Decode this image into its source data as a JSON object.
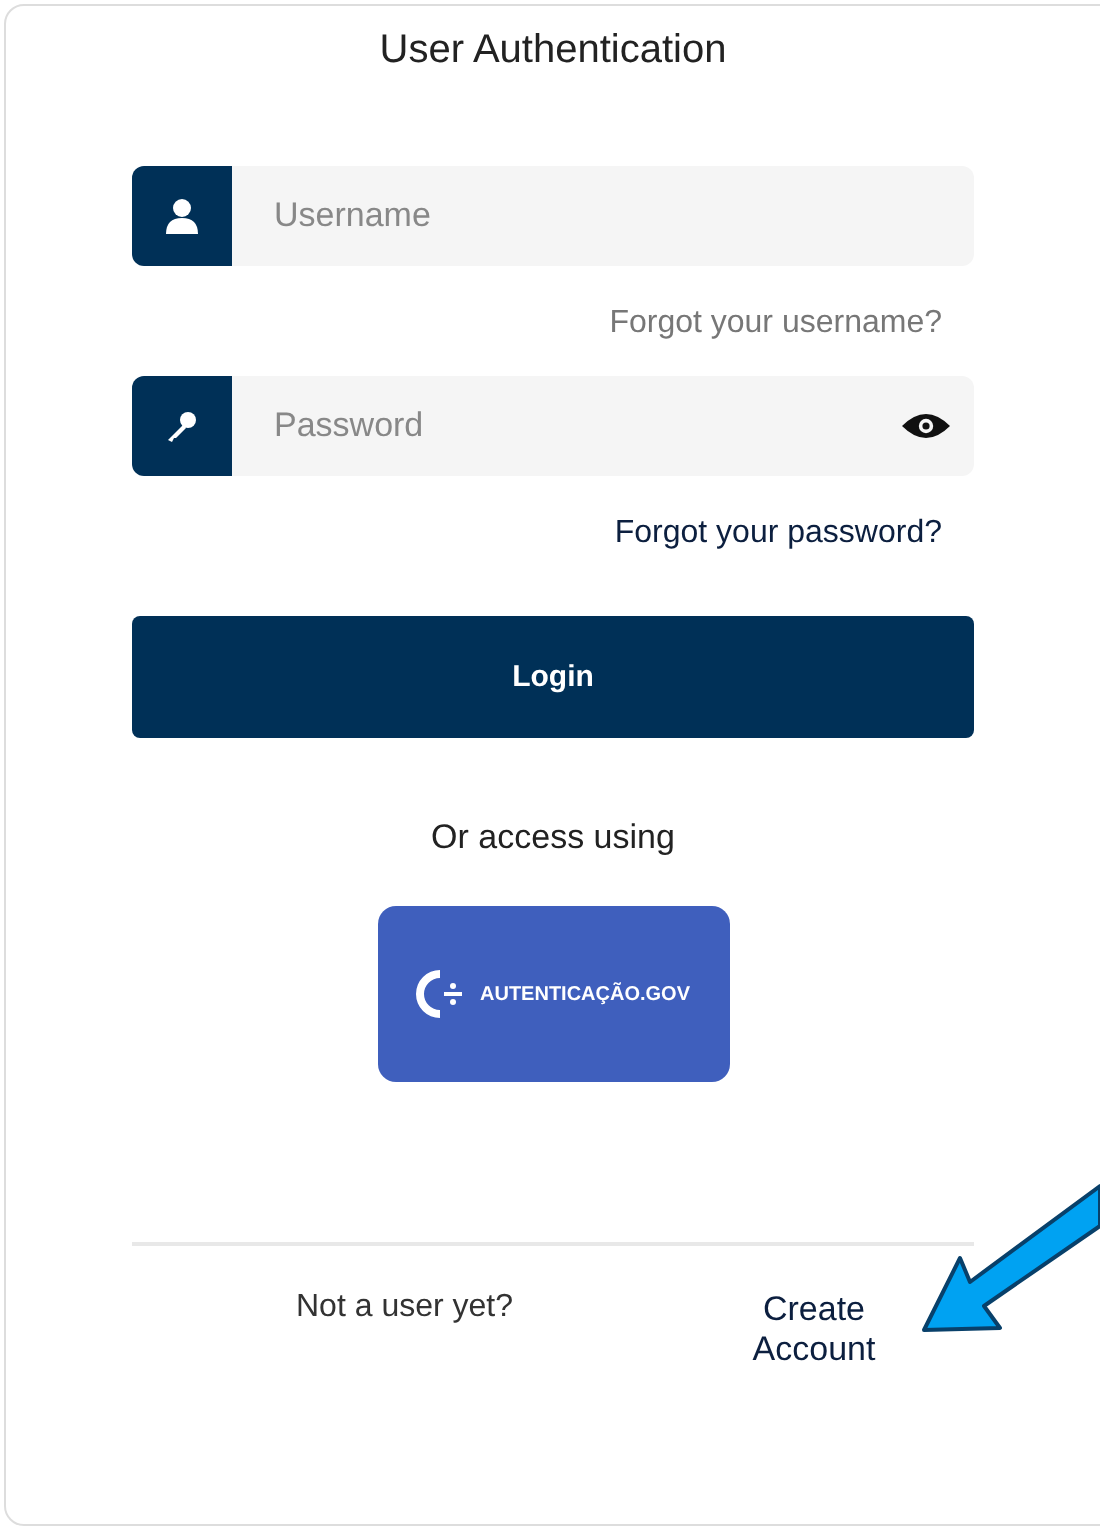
{
  "title": "User Authentication",
  "username_field": {
    "placeholder": "Username"
  },
  "forgot_username": "Forgot your username?",
  "password_field": {
    "placeholder": "Password"
  },
  "forgot_password": "Forgot your password?",
  "login_button": "Login",
  "alt_access": {
    "label": "Or access using",
    "button": "AUTENTICAÇÃO.GOV"
  },
  "footer": {
    "prompt": "Not a user yet?",
    "link": "Create Account"
  }
}
